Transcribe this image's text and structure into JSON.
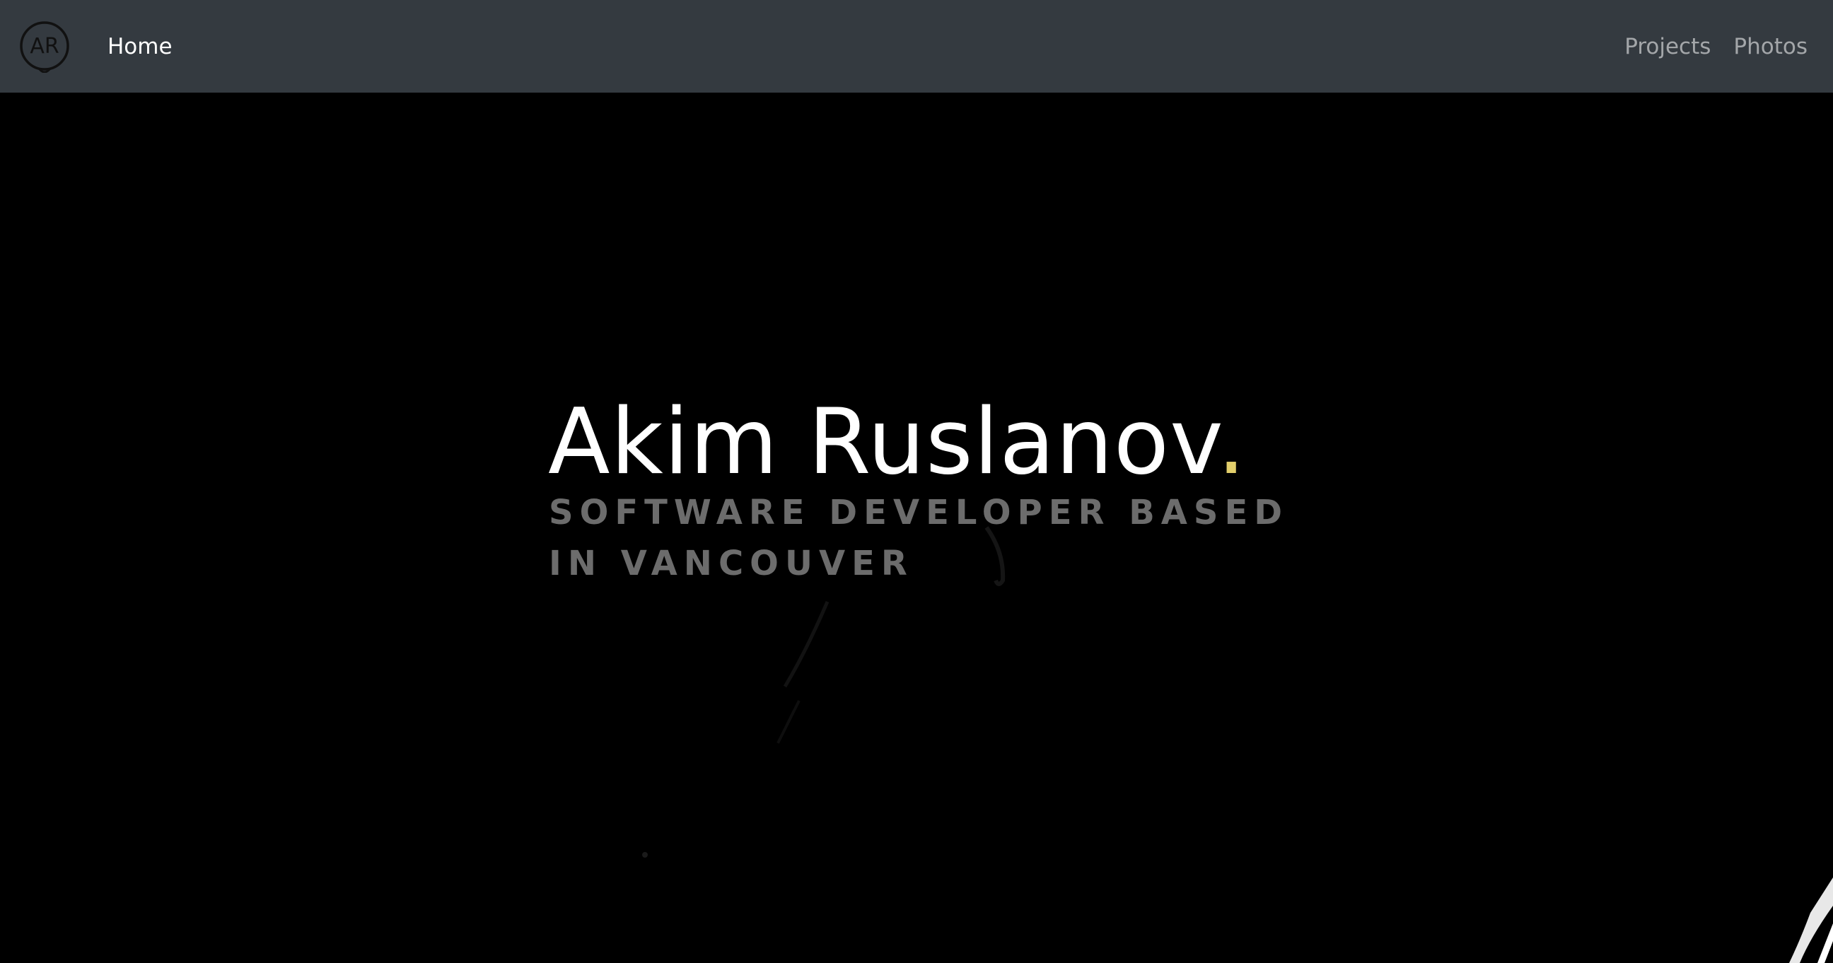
{
  "navbar": {
    "logo_text": "AR",
    "home_label": "Home",
    "links": [
      {
        "label": "Projects"
      },
      {
        "label": "Photos"
      }
    ]
  },
  "hero": {
    "name": "Akim Ruslanov",
    "name_suffix": ".",
    "subtitle": "SOFTWARE DEVELOPER BASED IN VANCOUVER"
  },
  "colors": {
    "navbar_bg": "#343a40",
    "accent_dot": "#e2cf6b",
    "hero_bg": "#000000"
  }
}
